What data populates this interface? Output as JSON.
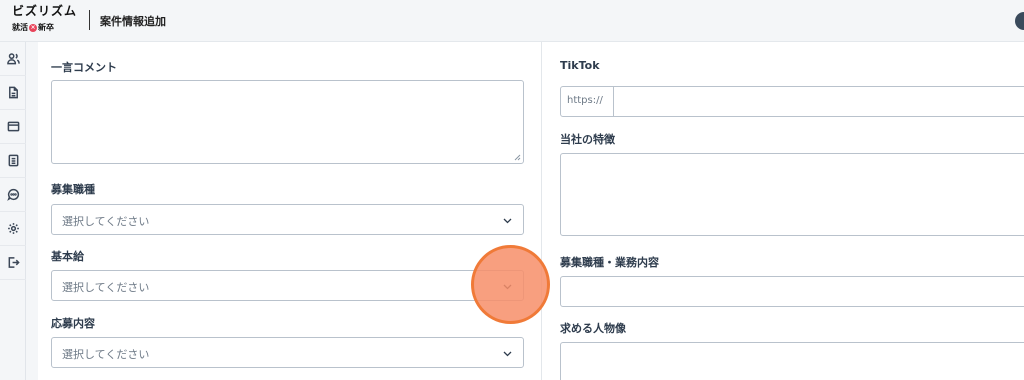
{
  "header": {
    "logo_main": "ビズリズム",
    "logo_sub_left": "就活",
    "logo_sub_mark": "×",
    "logo_sub_right": "新卒",
    "title": "案件情報追加"
  },
  "sidebar": {
    "icons": [
      "users-icon",
      "document-icon",
      "card-icon",
      "list-document-icon",
      "chat-icon",
      "gear-icon",
      "logout-icon"
    ]
  },
  "form_left": {
    "comment_label": "一言コメント",
    "job_type_label": "募集職種",
    "job_type_placeholder": "選択してください",
    "base_salary_label": "基本給",
    "base_salary_placeholder": "選択してください",
    "application_label": "応募内容",
    "application_placeholder": "選択してください"
  },
  "form_right": {
    "tiktok_label": "TikTok",
    "tiktok_prefix": "https://",
    "features_label": "当社の特徴",
    "job_detail_label": "募集職種・業務内容",
    "ideal_candidate_label": "求める人物像"
  },
  "colors": {
    "touch_indicator": "#f78e68",
    "touch_border": "#f07a38",
    "field_border": "#b9c2cc",
    "sidebar_bg": "#f4f6f8"
  }
}
